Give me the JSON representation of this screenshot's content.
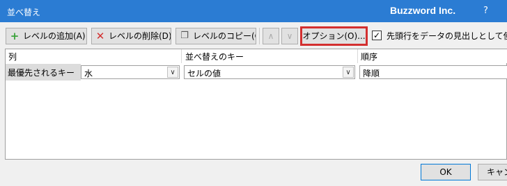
{
  "window": {
    "title": "並べ替え",
    "brand": "Buzzword Inc.",
    "help": "?"
  },
  "toolbar": {
    "add_level": "レベルの追加(A)",
    "delete_level": "レベルの削除(D)",
    "copy_level": "レベルのコピー(C)",
    "move_up": "∧",
    "move_down": "∨",
    "options": "オプション(O)...",
    "header_checkbox_label": "先頭行をデータの見出しとして使用す",
    "header_checkbox_checked": true
  },
  "grid": {
    "columns": [
      "列",
      "並べ替えのキー",
      "順序"
    ],
    "rows": [
      {
        "label": "最優先されるキー",
        "column": "水",
        "key": "セルの値",
        "order": "降順"
      }
    ]
  },
  "footer": {
    "ok": "OK",
    "cancel": "キャン"
  },
  "colors": {
    "titlebar": "#2b7cd3",
    "highlight": "#d32f2f",
    "add_icon": "#3aa23a"
  },
  "icons": {
    "add": "plus-icon",
    "delete": "x-icon",
    "copy": "copy-icon",
    "checkbox": "check-icon",
    "dropdown": "chevron-down-icon"
  }
}
